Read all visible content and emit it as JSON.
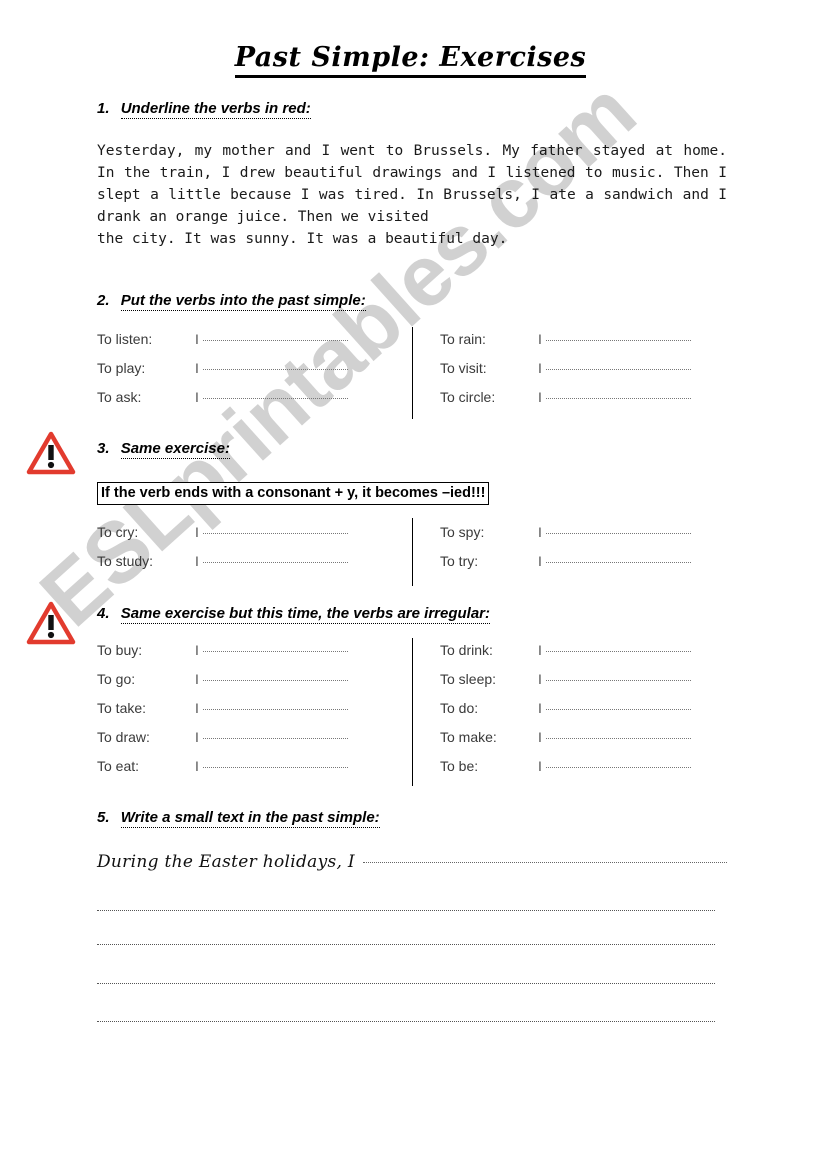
{
  "document": {
    "title": "Past Simple: Exercises",
    "watermark": "ESLprintables.com"
  },
  "exercise1": {
    "number": "1.",
    "heading": "Underline the verbs in red:",
    "paragraph": "Yesterday, my mother and I went to Brussels. My father stayed at home. In the train, I drew beautiful drawings and I listened to music. Then I slept a little because I was tired. In Brussels, I ate a sandwich and I drank an orange juice. Then we visited",
    "paragraph_last_line": "the city. It was sunny. It was a beautiful day."
  },
  "exercise2": {
    "number": "2.",
    "heading": "Put the verbs into the past simple:",
    "answer_prefix": "I",
    "left_column": [
      {
        "label": "To listen:"
      },
      {
        "label": "To play:"
      },
      {
        "label": "To ask:"
      }
    ],
    "right_column": [
      {
        "label": "To rain:"
      },
      {
        "label": "To visit:"
      },
      {
        "label": "To circle:"
      }
    ]
  },
  "exercise3": {
    "number": "3.",
    "heading": "Same exercise:",
    "warning_icon": "warning-triangle-icon",
    "rule": "If the verb ends with a consonant + y, it becomes –ied!!!",
    "answer_prefix": "I",
    "left_column": [
      {
        "label": "To cry:"
      },
      {
        "label": "To study:"
      }
    ],
    "right_column": [
      {
        "label": "To spy:"
      },
      {
        "label": "To try:"
      }
    ]
  },
  "exercise4": {
    "number": "4.",
    "heading": "Same exercise but this time, the verbs are irregular:",
    "warning_icon": "warning-triangle-icon",
    "answer_prefix": "I",
    "left_column": [
      {
        "label": "To buy:"
      },
      {
        "label": "To go:"
      },
      {
        "label": "To take:"
      },
      {
        "label": "To draw:"
      },
      {
        "label": "To eat:"
      }
    ],
    "right_column": [
      {
        "label": "To drink:"
      },
      {
        "label": "To sleep:"
      },
      {
        "label": "To do:"
      },
      {
        "label": "To make:"
      },
      {
        "label": "To be:"
      }
    ]
  },
  "exercise5": {
    "number": "5.",
    "heading": "Write a small text in the past simple:",
    "prompt": "During the Easter holidays, I",
    "blank_lines": 4
  },
  "colors": {
    "warning_red": "#e23b2e",
    "watermark_gray": "#c9c9c9",
    "text_black": "#000000"
  }
}
